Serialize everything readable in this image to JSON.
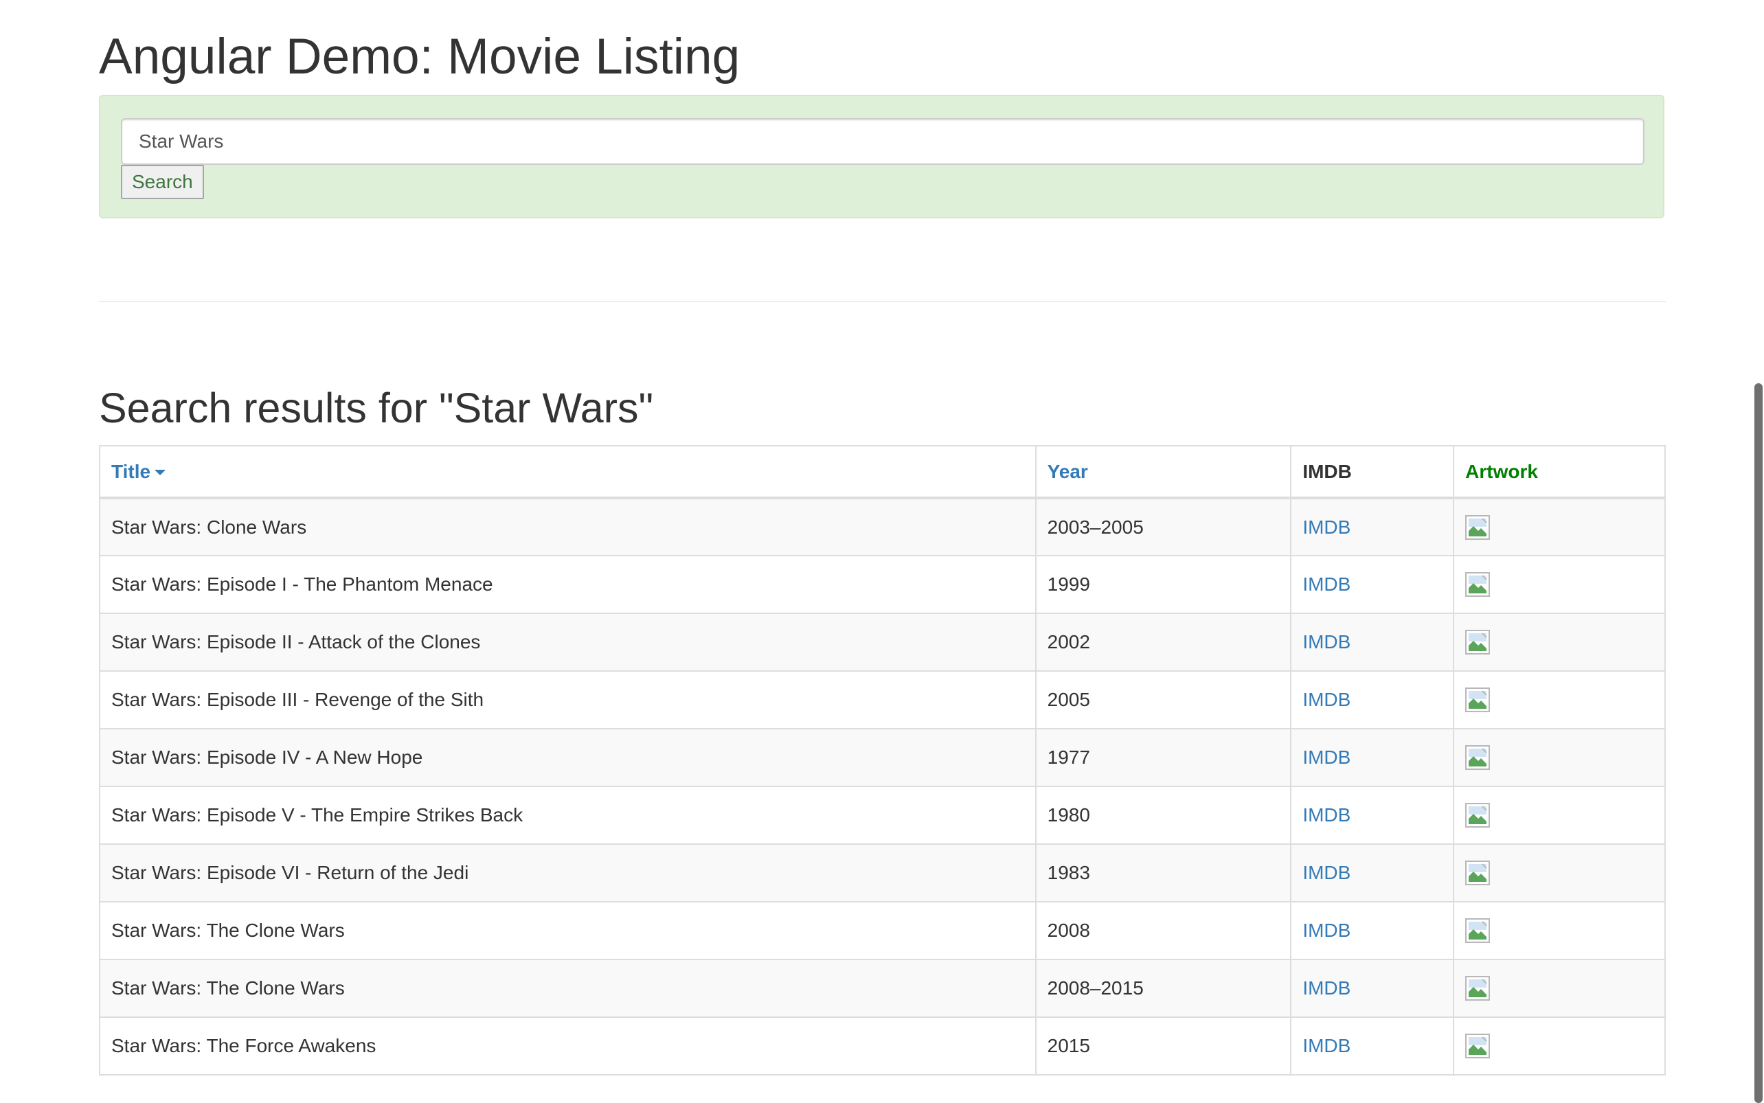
{
  "app": {
    "title": "Angular Demo: Movie Listing"
  },
  "search": {
    "value": "Star Wars",
    "button_label": "Search"
  },
  "results": {
    "heading": "Search results for \"Star Wars\"",
    "columns": {
      "title": "Title",
      "year": "Year",
      "imdb": "IMDB",
      "artwork": "Artwork"
    },
    "sort": {
      "column": "title",
      "direction": "descending"
    },
    "rows": [
      {
        "title": "Star Wars: Clone Wars",
        "year": "2003–2005",
        "imdb": "IMDB",
        "artwork_icon": "broken-image-icon"
      },
      {
        "title": "Star Wars: Episode I - The Phantom Menace",
        "year": "1999",
        "imdb": "IMDB",
        "artwork_icon": "broken-image-icon"
      },
      {
        "title": "Star Wars: Episode II - Attack of the Clones",
        "year": "2002",
        "imdb": "IMDB",
        "artwork_icon": "broken-image-icon"
      },
      {
        "title": "Star Wars: Episode III - Revenge of the Sith",
        "year": "2005",
        "imdb": "IMDB",
        "artwork_icon": "broken-image-icon"
      },
      {
        "title": "Star Wars: Episode IV - A New Hope",
        "year": "1977",
        "imdb": "IMDB",
        "artwork_icon": "broken-image-icon"
      },
      {
        "title": "Star Wars: Episode V - The Empire Strikes Back",
        "year": "1980",
        "imdb": "IMDB",
        "artwork_icon": "broken-image-icon"
      },
      {
        "title": "Star Wars: Episode VI - Return of the Jedi",
        "year": "1983",
        "imdb": "IMDB",
        "artwork_icon": "broken-image-icon"
      },
      {
        "title": "Star Wars: The Clone Wars",
        "year": "2008",
        "imdb": "IMDB",
        "artwork_icon": "broken-image-icon"
      },
      {
        "title": "Star Wars: The Clone Wars",
        "year": "2008–2015",
        "imdb": "IMDB",
        "artwork_icon": "broken-image-icon"
      },
      {
        "title": "Star Wars: The Force Awakens",
        "year": "2015",
        "imdb": "IMDB",
        "artwork_icon": "broken-image-icon"
      }
    ]
  },
  "colors": {
    "panel_background": "#dff0d8",
    "link": "#337ab7",
    "artwork_header": "#008000",
    "search_button_text": "#3c763d"
  }
}
